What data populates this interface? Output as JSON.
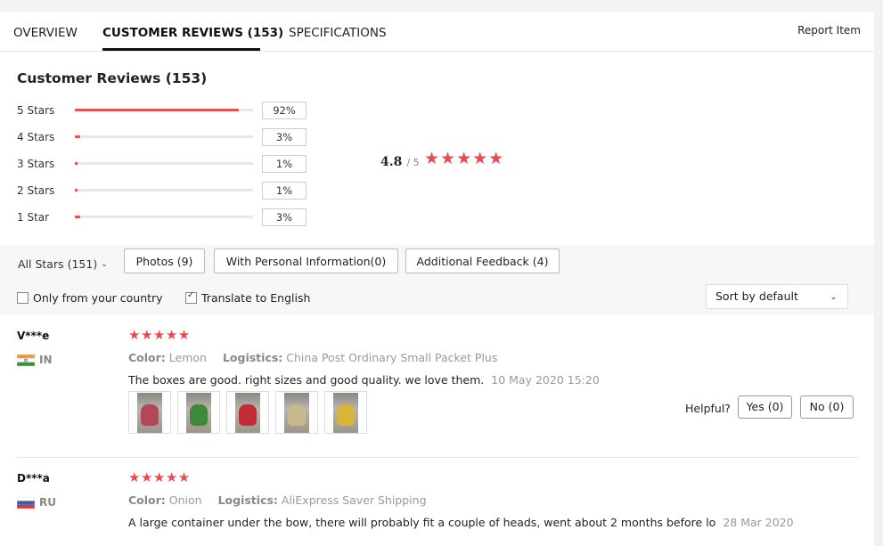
{
  "tabs": {
    "overview": "OVERVIEW",
    "reviews": "CUSTOMER REVIEWS (153)",
    "specs": "SPECIFICATIONS",
    "report": "Report Item"
  },
  "summary": {
    "title": "Customer Reviews (153)",
    "rows": [
      {
        "label": "5 Stars",
        "pct": "92%",
        "fill": 0.92
      },
      {
        "label": "4 Stars",
        "pct": "3%",
        "fill": 0.03
      },
      {
        "label": "3 Stars",
        "pct": "1%",
        "fill": 0.01
      },
      {
        "label": "2 Stars",
        "pct": "1%",
        "fill": 0.01
      },
      {
        "label": "1 Star",
        "pct": "3%",
        "fill": 0.03
      }
    ],
    "score": "4.8",
    "score_of": "/ 5",
    "stars": "★★★★★"
  },
  "filters": {
    "all_stars": "All Stars (151)",
    "photos": "Photos (9)",
    "personal": "With Personal Information(0)",
    "additional": "Additional Feedback (4)",
    "only_country": "Only from your country",
    "translate": "Translate to English",
    "sort": "Sort by default"
  },
  "reviews": [
    {
      "name": "V***e",
      "country": "IN",
      "stars": "★★★★★",
      "color_label": "Color:",
      "color": "Lemon",
      "logistics_label": "Logistics:",
      "logistics": "China Post Ordinary Small Packet Plus",
      "text": "The boxes are good. right sizes and good quality. we love them.",
      "date": "10 May 2020 15:20",
      "helpful": "Helpful?",
      "yes": "Yes (0)",
      "no": "No (0)",
      "thumb_colors": [
        "#b1485a",
        "#3e8a3a",
        "#c22c34",
        "#c9b98f",
        "#d7b43a"
      ]
    },
    {
      "name": "D***a",
      "country": "RU",
      "stars": "★★★★★",
      "color_label": "Color:",
      "color": "Onion",
      "logistics_label": "Logistics:",
      "logistics": "AliExpress Saver Shipping",
      "text": "A large container under the bow, there will probably fit a couple of heads, went about 2 months before lo",
      "date": "28 Mar 2020"
    }
  ]
}
